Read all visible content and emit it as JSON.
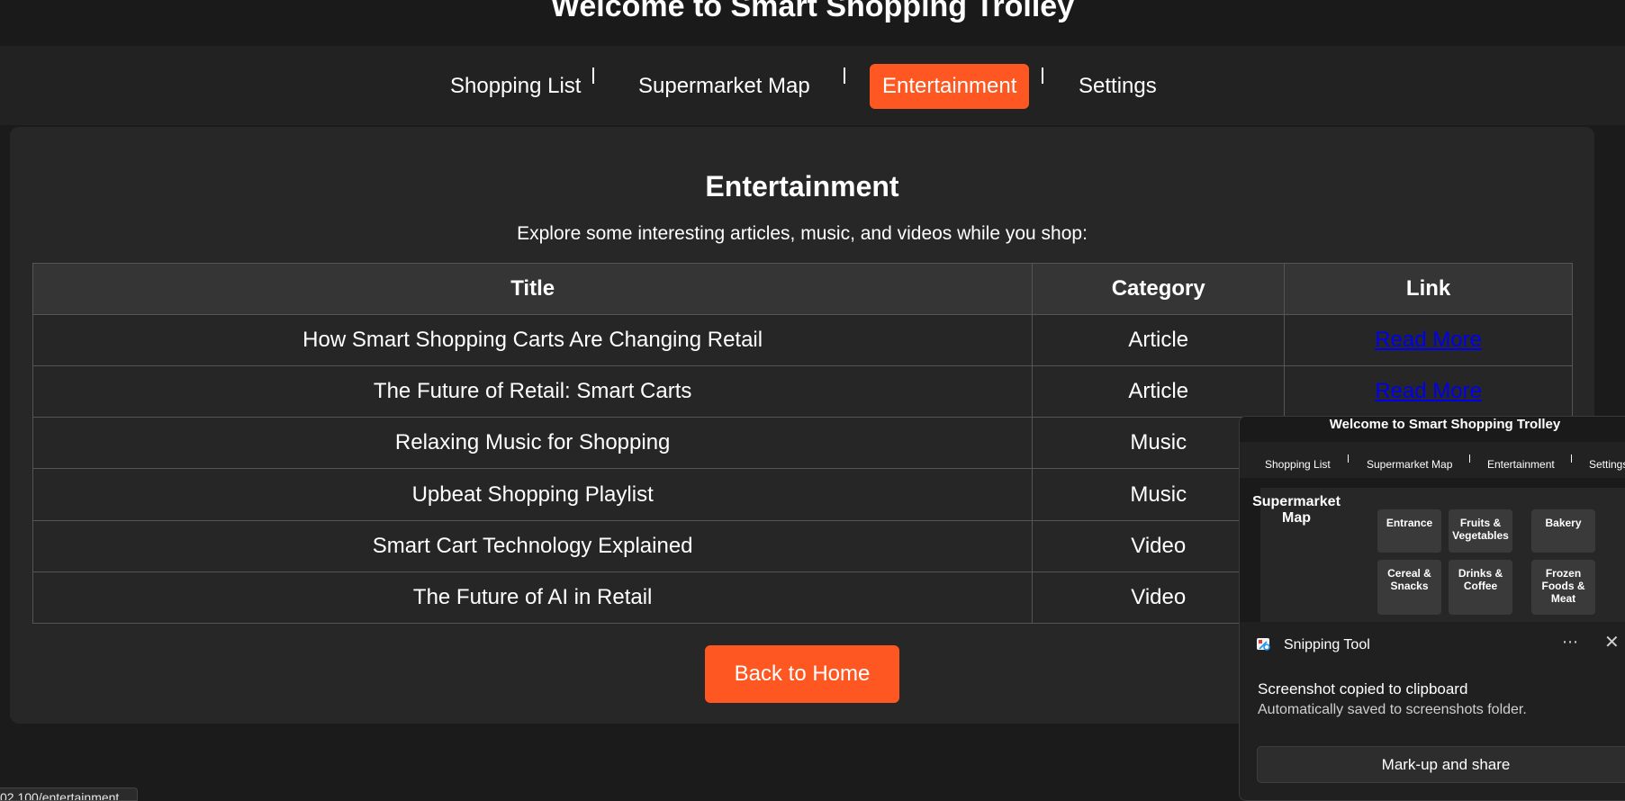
{
  "header": {
    "title": "Welcome to Smart Shopping Trolley"
  },
  "nav": {
    "items": [
      "Shopping List",
      "Supermarket Map",
      "Entertainment",
      "Settings"
    ],
    "active": "Entertainment"
  },
  "page": {
    "heading": "Entertainment",
    "intro": "Explore some interesting articles, music, and videos while you shop:",
    "table": {
      "headers": [
        "Title",
        "Category",
        "Link"
      ],
      "rows": [
        {
          "title": "How Smart Shopping Carts Are Changing Retail",
          "category": "Article",
          "link": "Read More"
        },
        {
          "title": "The Future of Retail: Smart Carts",
          "category": "Article",
          "link": "Read More"
        },
        {
          "title": "Relaxing Music for Shopping",
          "category": "Music",
          "link": ""
        },
        {
          "title": "Upbeat Shopping Playlist",
          "category": "Music",
          "link": ""
        },
        {
          "title": "Smart Cart Technology Explained",
          "category": "Video",
          "link": ""
        },
        {
          "title": "The Future of AI in Retail",
          "category": "Video",
          "link": ""
        }
      ]
    },
    "back_button": "Back to Home"
  },
  "status_bar": {
    "url": "02.100/entertainment"
  },
  "snipping_tool": {
    "app_name": "Snipping Tool",
    "more_icon": "ellipsis-icon",
    "close_icon": "close-icon",
    "message": "Screenshot copied to clipboard",
    "sub_message": "Automatically saved to screenshots folder.",
    "action_button": "Mark-up and share",
    "thumbnail": {
      "title": "Welcome to Smart Shopping Trolley",
      "nav": [
        "Shopping List",
        "Supermarket Map",
        "Entertainment",
        "Settings"
      ],
      "map_title": "Supermarket Map",
      "sections": [
        "Entrance",
        "Fruits & Vegetables",
        "Bakery",
        "Cereal & Snacks",
        "Drinks & Coffee",
        "Frozen Foods & Meat"
      ]
    }
  },
  "colors": {
    "accent": "#ff5722",
    "background": "#1b1b1b",
    "card": "#272727",
    "link": "#0000ee"
  }
}
